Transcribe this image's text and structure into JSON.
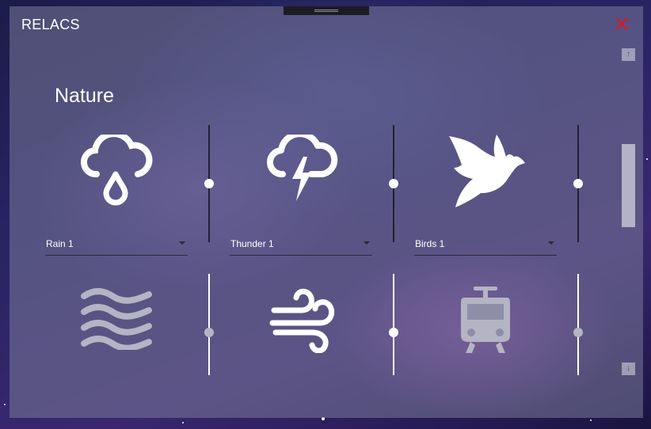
{
  "app": {
    "title": "RELACS"
  },
  "section": {
    "title": "Nature"
  },
  "colors": {
    "close": "#e81123",
    "accent": "#ffffff",
    "inactive": "#b4b4c4",
    "track_dark": "#22222e"
  },
  "sounds": [
    {
      "icon": "rain-icon",
      "dropdown": "Rain 1",
      "active": true,
      "volume": 0.5
    },
    {
      "icon": "thunder-icon",
      "dropdown": "Thunder 1",
      "active": true,
      "volume": 0.5
    },
    {
      "icon": "bird-icon",
      "dropdown": "Birds 1",
      "active": true,
      "volume": 0.5
    },
    {
      "icon": "waves-icon",
      "active": false,
      "volume": 0.5
    },
    {
      "icon": "wind-icon",
      "active": true,
      "volume": 0.5
    },
    {
      "icon": "train-icon",
      "active": false,
      "volume": 0.5
    }
  ],
  "scrollbar": {
    "up_icon": "arrow-up-icon",
    "down_icon": "arrow-down-icon"
  }
}
